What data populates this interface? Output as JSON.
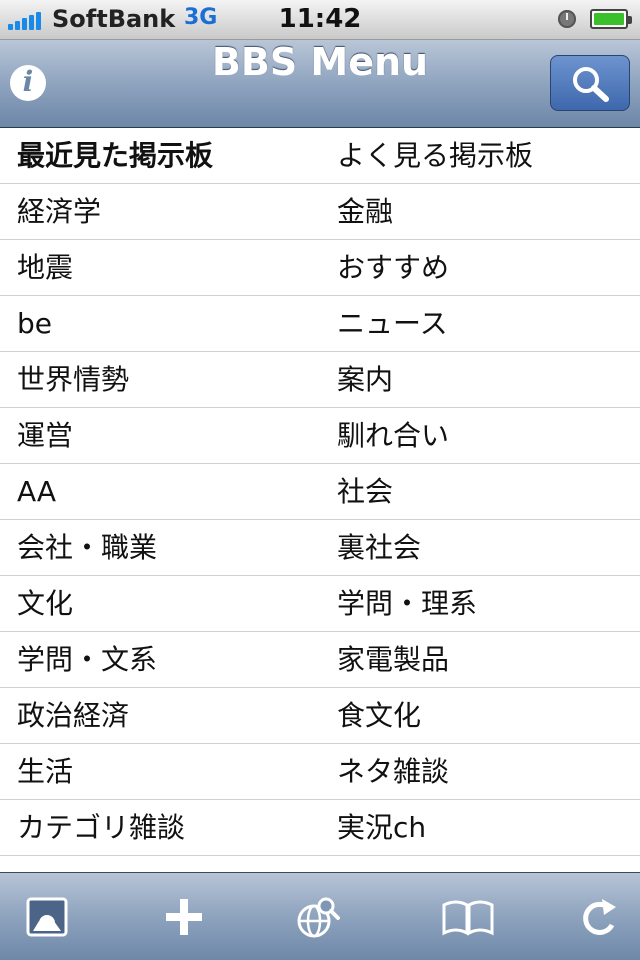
{
  "status_bar": {
    "carrier": "SoftBank",
    "network": "3G",
    "time": "11:42",
    "battery_level": 1.0,
    "signal_bars": 5,
    "colors": {
      "signal": "#1a8ae8",
      "network": "#1a6fd4",
      "battery": "#39c02b"
    }
  },
  "nav": {
    "title": "BBS Menu",
    "info_icon": "info-icon",
    "search_icon": "search-icon"
  },
  "menu": {
    "rows": [
      {
        "left": "最近見た掲示板",
        "right": "よく見る掲示板",
        "left_bold": true
      },
      {
        "left": "経済学",
        "right": "金融"
      },
      {
        "left": "地震",
        "right": "おすすめ"
      },
      {
        "left": "be",
        "right": "ニュース"
      },
      {
        "left": "世界情勢",
        "right": "案内"
      },
      {
        "left": "運営",
        "right": "馴れ合い"
      },
      {
        "left": "AA",
        "right": "社会"
      },
      {
        "left": "会社・職業",
        "right": "裏社会"
      },
      {
        "left": "文化",
        "right": "学問・理系"
      },
      {
        "left": "学問・文系",
        "right": "家電製品"
      },
      {
        "left": "政治経済",
        "right": "食文化"
      },
      {
        "left": "生活",
        "right": "ネタ雑談"
      },
      {
        "left": "カテゴリ雑談",
        "right": "実況ch"
      }
    ]
  },
  "toolbar": {
    "buttons": [
      "gallery-icon",
      "plus-icon",
      "globe-search-icon",
      "bookmarks-icon",
      "reload-icon"
    ]
  },
  "colors": {
    "nav_gradient_top": "#b9c6d7",
    "nav_gradient_bottom": "#6d87a8",
    "search_button": "#3e68ad",
    "row_divider": "#d2d2d2"
  }
}
